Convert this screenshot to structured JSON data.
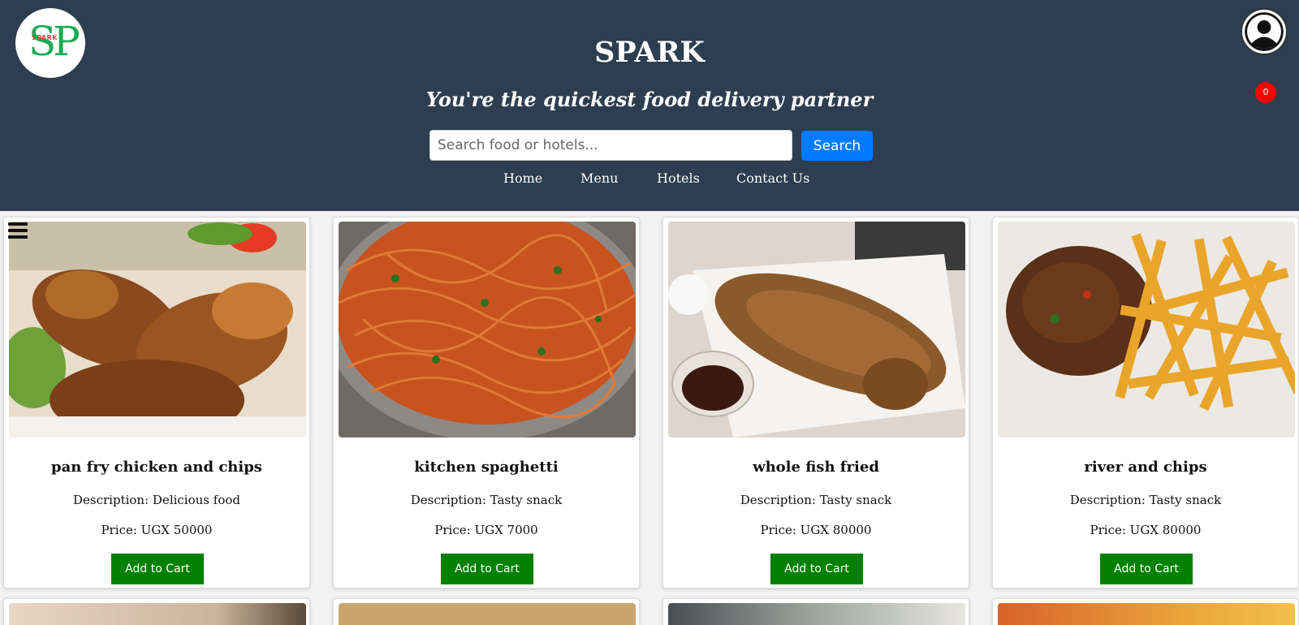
{
  "header": {
    "title": "SPARK",
    "tagline": "You're the quickest food delivery partner",
    "logo_text": "SP",
    "logo_subtext": "SPARK",
    "background_color": "#2c3e50"
  },
  "search": {
    "placeholder": "Search food or hotels...",
    "value": "",
    "button_label": "Search",
    "button_color": "#007bff"
  },
  "nav": {
    "items": [
      {
        "label": "Home"
      },
      {
        "label": "Menu"
      },
      {
        "label": "Hotels"
      },
      {
        "label": "Contact Us"
      }
    ]
  },
  "user": {
    "avatar_icon": "user-circle-icon",
    "cart_count": "0",
    "badge_color": "#ff0000"
  },
  "menu_icon": "hamburger-icon",
  "products": [
    {
      "name": "pan fry chicken and chips",
      "description": "Description: Delicious food",
      "price": "Price: UGX 50000",
      "button_label": "Add to Cart",
      "image": "fried chicken"
    },
    {
      "name": "kitchen spaghetti",
      "description": "Description: Tasty snack",
      "price": "Price: UGX 7000",
      "button_label": "Add to Cart",
      "image": "spaghetti"
    },
    {
      "name": "whole fish fried",
      "description": "Description: Tasty snack",
      "price": "Price: UGX 80000",
      "button_label": "Add to Cart",
      "image": "fried fish"
    },
    {
      "name": "river and chips",
      "description": "Description: Tasty snack",
      "price": "Price: UGX 80000",
      "button_label": "Add to Cart",
      "image": "liver and chips"
    }
  ],
  "add_button_color": "#008000"
}
